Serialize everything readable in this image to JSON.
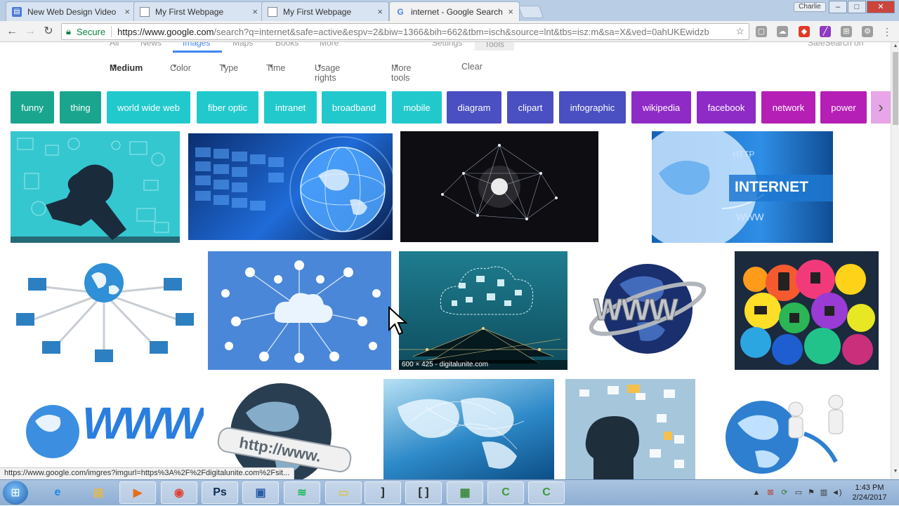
{
  "browser": {
    "tabs": [
      {
        "label": "New Web Design Video",
        "icon": "video-doc-icon",
        "close": "×"
      },
      {
        "label": "My First Webpage",
        "icon": "page-icon",
        "close": "×"
      },
      {
        "label": "My First Webpage",
        "icon": "page-icon",
        "close": "×"
      },
      {
        "label": "internet - Google Search",
        "icon": "google-icon",
        "close": "×"
      }
    ],
    "profile_name": "Charlie",
    "window_buttons": {
      "minimize": "–",
      "maximize": "□",
      "close": "✕"
    },
    "secure_label": "Secure",
    "url_host": "https://www.google.com",
    "url_rest": "/search?q=internet&safe=active&espv=2&biw=1366&bih=662&tbm=isch&source=lnt&tbs=isz:m&sa=X&ved=0ahUKEwidzb",
    "status_url": "https://www.google.com/imgres?imgurl=https%3A%2F%2Fdigitalunite.com%2Fsit..."
  },
  "search": {
    "top_tabs": [
      "All",
      "News",
      "Images",
      "Maps",
      "Books",
      "More",
      "Settings",
      "Tools"
    ],
    "safesearch": "SafeSearch on",
    "filters": [
      {
        "label": "Medium",
        "dropdown": true
      },
      {
        "label": "Color",
        "dropdown": true
      },
      {
        "label": "Type",
        "dropdown": true
      },
      {
        "label": "Time",
        "dropdown": true
      },
      {
        "label": "Usage rights",
        "dropdown": true
      },
      {
        "label": "More tools",
        "dropdown": true
      },
      {
        "label": "Clear",
        "dropdown": false
      }
    ],
    "chips": [
      {
        "label": "funny",
        "color": "#1aa68e"
      },
      {
        "label": "thing",
        "color": "#1aa68e"
      },
      {
        "label": "world wide web",
        "color": "#22c9cc"
      },
      {
        "label": "fiber optic",
        "color": "#22c9cc"
      },
      {
        "label": "intranet",
        "color": "#22c9cc"
      },
      {
        "label": "broadband",
        "color": "#22c9cc"
      },
      {
        "label": "mobile",
        "color": "#22c9cc"
      },
      {
        "label": "diagram",
        "color": "#4a4fc1"
      },
      {
        "label": "clipart",
        "color": "#4a4fc1"
      },
      {
        "label": "infographic",
        "color": "#4a4fc1"
      },
      {
        "label": "wikipedia",
        "color": "#8e2bc6"
      },
      {
        "label": "facebook",
        "color": "#8e2bc6"
      },
      {
        "label": "network",
        "color": "#b51fb5"
      },
      {
        "label": "power",
        "color": "#b51fb5"
      }
    ],
    "image_text": {
      "internet_banner": "INTERNET",
      "http_label": "HTTP",
      "www_label": "WWW",
      "www_big": "WWW",
      "http_globe": "http://www.",
      "caption": "600 × 425 - digitalunite.com"
    }
  },
  "taskbar": {
    "items": [
      {
        "name": "internet-explorer-icon",
        "glyph": "e",
        "color": "#1e88e5"
      },
      {
        "name": "file-explorer-icon",
        "glyph": "▤",
        "color": "#e6b84a"
      },
      {
        "name": "media-player-icon",
        "glyph": "▶",
        "color": "#e86c1a"
      },
      {
        "name": "chrome-icon",
        "glyph": "◉",
        "color": "#db4437"
      },
      {
        "name": "photoshop-icon",
        "glyph": "Ps",
        "color": "#0b2d4f"
      },
      {
        "name": "presentation-icon",
        "glyph": "▣",
        "color": "#2a5caa"
      },
      {
        "name": "spotify-icon",
        "glyph": "≋",
        "color": "#1db954"
      },
      {
        "name": "folder-icon",
        "glyph": "▭",
        "color": "#d9c257"
      },
      {
        "name": "ide-icon",
        "glyph": "]",
        "color": "#222"
      },
      {
        "name": "brackets-icon",
        "glyph": "[ ]",
        "color": "#222"
      },
      {
        "name": "spreadsheet-icon",
        "glyph": "▦",
        "color": "#3b8b3b"
      },
      {
        "name": "camtasia-icon",
        "glyph": "C",
        "color": "#3f9a3a"
      },
      {
        "name": "camtasia-recorder-icon",
        "glyph": "C",
        "color": "#3f9a3a"
      }
    ],
    "clock_time": "1:43 PM",
    "clock_date": "2/24/2017"
  }
}
